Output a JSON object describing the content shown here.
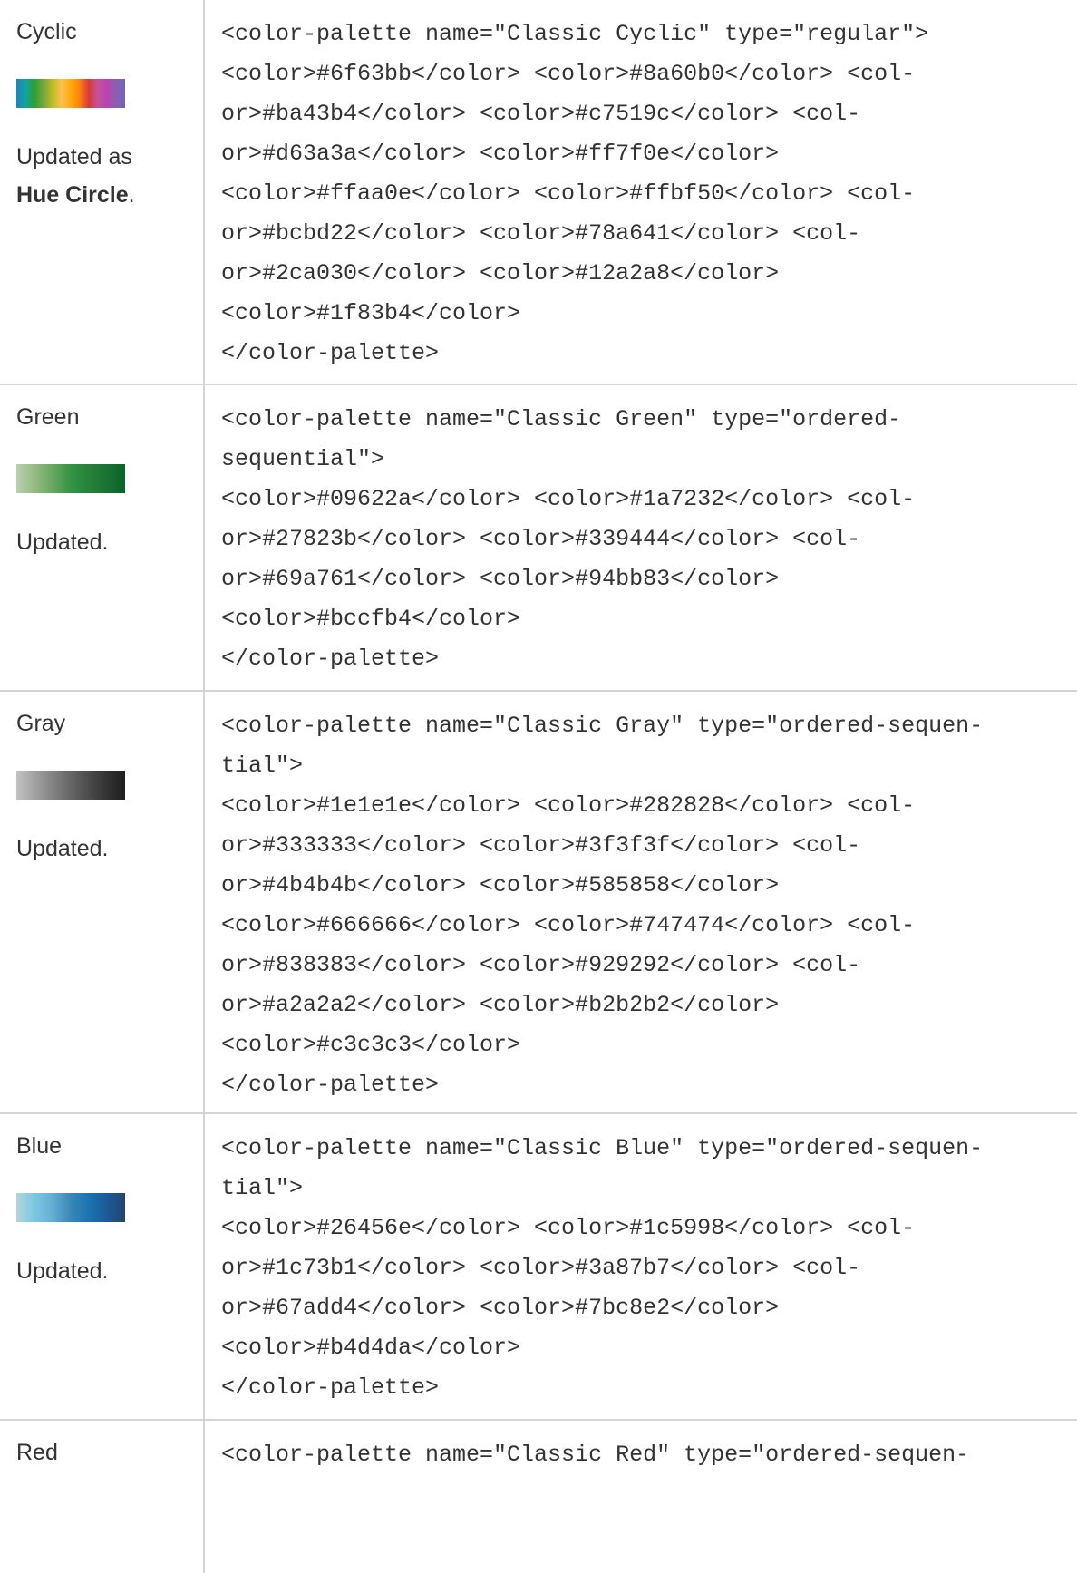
{
  "rows": [
    {
      "name": "Cyclic",
      "swatch_colors": [
        "#1f83b4",
        "#12a2a8",
        "#2ca030",
        "#78a641",
        "#bcbd22",
        "#ffbf50",
        "#ffaa0e",
        "#ff7f0e",
        "#d63a3a",
        "#c7519c",
        "#ba43b4",
        "#8a60b0",
        "#6f63bb"
      ],
      "note_prefix": "Updated as",
      "note_bold": "Hue Circle",
      "note_suffix": ".",
      "code": "<color-palette name=\"Classic Cyclic\" type=\"regular\">\n<color>#6f63bb</color> <color>#8a60b0</color> <col-\nor>#ba43b4</color> <color>#c7519c</color> <col-\nor>#d63a3a</color> <color>#ff7f0e</color>\n<color>#ffaa0e</color> <color>#ffbf50</color> <col-\nor>#bcbd22</color> <color>#78a641</color> <col-\nor>#2ca030</color> <color>#12a2a8</color>\n<color>#1f83b4</color>\n</color-palette>"
    },
    {
      "name": "Green",
      "swatch_colors": [
        "#bccfb4",
        "#94bb83",
        "#69a761",
        "#339444",
        "#27823b",
        "#1a7232",
        "#09622a"
      ],
      "note_prefix": "Updated.",
      "note_bold": "",
      "note_suffix": "",
      "code": "<color-palette name=\"Classic Green\" type=\"ordered-\nsequential\">\n<color>#09622a</color> <color>#1a7232</color> <col-\nor>#27823b</color> <color>#339444</color> <col-\nor>#69a761</color> <color>#94bb83</color>\n<color>#bccfb4</color>\n</color-palette>"
    },
    {
      "name": "Gray",
      "swatch_colors": [
        "#c3c3c3",
        "#a2a2a2",
        "#838383",
        "#666666",
        "#4b4b4b",
        "#333333",
        "#1e1e1e"
      ],
      "note_prefix": "Updated.",
      "note_bold": "",
      "note_suffix": "",
      "code": "<color-palette name=\"Classic Gray\" type=\"ordered-sequen-\ntial\">\n<color>#1e1e1e</color> <color>#282828</color> <col-\nor>#333333</color> <color>#3f3f3f</color> <col-\nor>#4b4b4b</color> <color>#585858</color>\n<color>#666666</color> <color>#747474</color> <col-\nor>#838383</color> <color>#929292</color> <col-\nor>#a2a2a2</color> <color>#b2b2b2</color>\n<color>#c3c3c3</color>\n</color-palette>"
    },
    {
      "name": "Blue",
      "swatch_colors": [
        "#b4d4da",
        "#7bc8e2",
        "#67add4",
        "#3a87b7",
        "#1c73b1",
        "#1c5998",
        "#26456e"
      ],
      "note_prefix": "Updated.",
      "note_bold": "",
      "note_suffix": "",
      "code": "<color-palette name=\"Classic Blue\" type=\"ordered-sequen-\ntial\">\n<color>#26456e</color> <color>#1c5998</color> <col-\nor>#1c73b1</color> <color>#3a87b7</color> <col-\nor>#67add4</color> <color>#7bc8e2</color>\n<color>#b4d4da</color>\n</color-palette>"
    },
    {
      "name": "Red",
      "swatch_colors": [],
      "note_prefix": "",
      "note_bold": "",
      "note_suffix": "",
      "code": "<color-palette name=\"Classic Red\" type=\"ordered-sequen-"
    }
  ]
}
